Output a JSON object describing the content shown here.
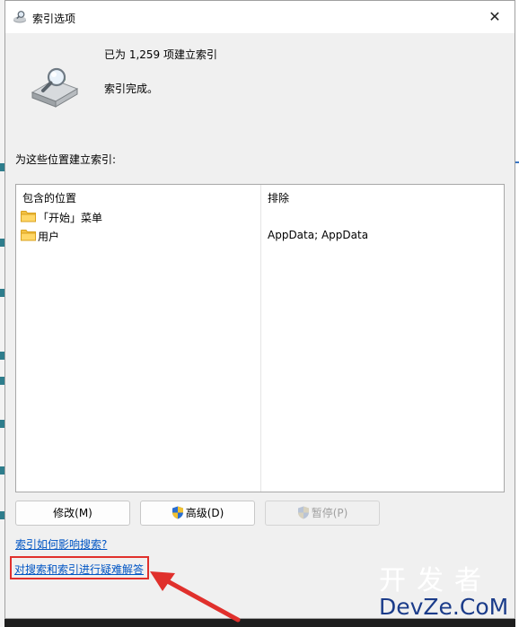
{
  "window": {
    "title": "索引选项"
  },
  "summary": {
    "indexed_count": "已为 1,259 项建立索引",
    "status": "索引完成。"
  },
  "locations": {
    "section_label": "为这些位置建立索引:",
    "columns": {
      "included": "包含的位置",
      "excluded": "排除"
    },
    "rows": [
      {
        "location": "「开始」菜单",
        "exclude": ""
      },
      {
        "location": "用户",
        "exclude": "AppData; AppData"
      }
    ]
  },
  "buttons": {
    "modify": "修改(M)",
    "advanced": "高级(D)",
    "pause": "暂停(P)"
  },
  "links": {
    "how_index_affects": "索引如何影响搜索?",
    "troubleshoot": "对搜索和索引进行疑难解答"
  },
  "watermark": {
    "line1": "开发者",
    "line2": "DevZe.CoM"
  },
  "colors": {
    "link": "#0055c4",
    "highlight": "#e0302c",
    "window_bg": "#f0f0f0"
  }
}
